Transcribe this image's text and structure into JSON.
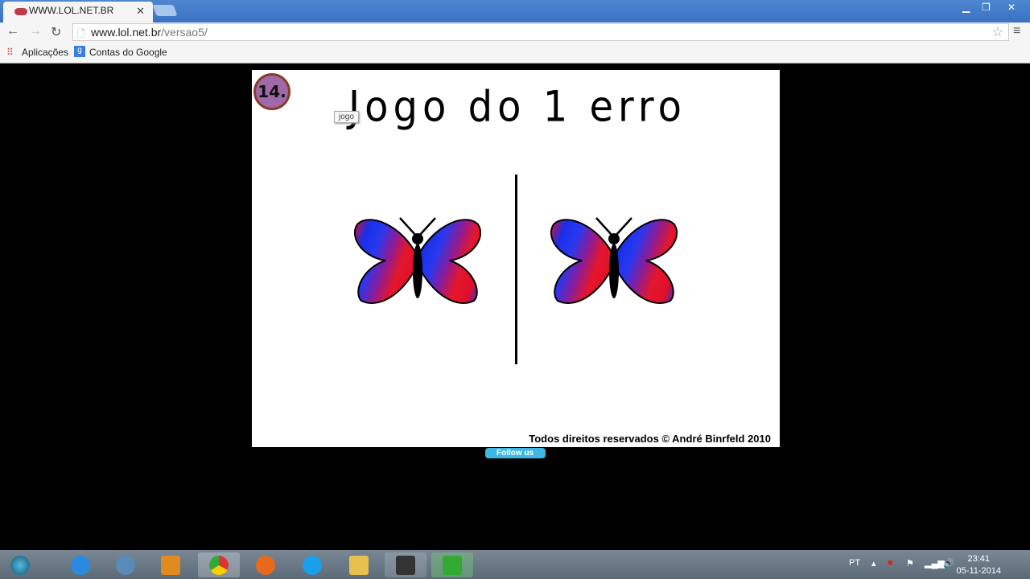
{
  "browser": {
    "tab_title": "WWW.LOL.NET.BR",
    "url_host": "www.lol.net.br",
    "url_path": "/versao5/",
    "bookmarks": [
      "Aplicações",
      "Contas do Google"
    ]
  },
  "game": {
    "level_badge": "14.",
    "title": "Jogo do 1 erro",
    "tooltip": "jogo",
    "copyright": "Todos direitos reservados © André Binrfeld  2010",
    "follow": "Follow us"
  },
  "taskbar": {
    "lang": "PT",
    "time": "23:41",
    "date": "05-11-2014"
  }
}
